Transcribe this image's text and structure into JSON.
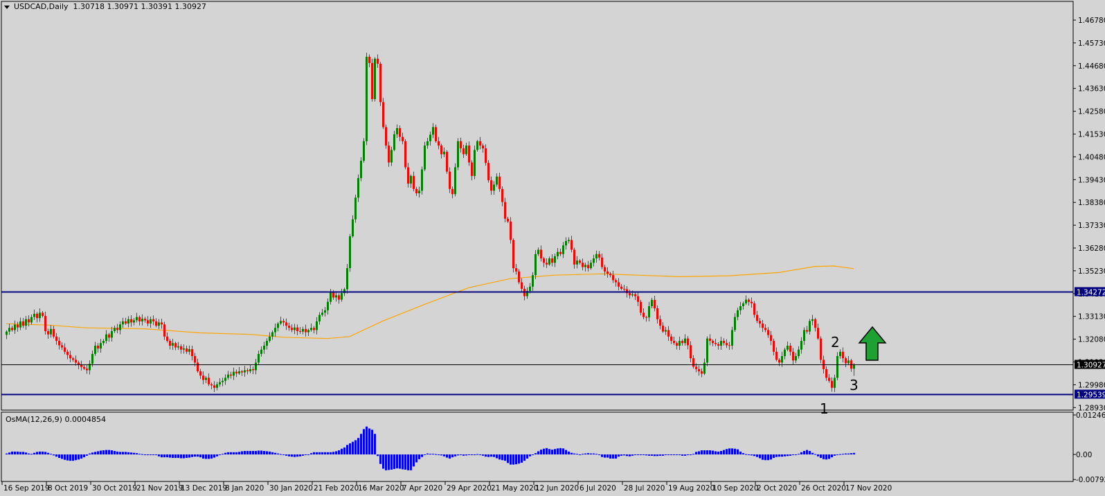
{
  "header": {
    "symbol": "USDCAD,Daily",
    "ohlc": "1.30718 1.30971 1.30391 1.30927"
  },
  "osma_label": {
    "name": "OsMA(12,26,9)",
    "value": "0.0004854"
  },
  "colors": {
    "background": "#d4d4d4",
    "bull": "#008000",
    "bear": "#ff0000",
    "ma": "#ffa500",
    "level": "#000080",
    "bid": "#000000",
    "osma": "#0000ff",
    "arrow": "#1ea133"
  },
  "annotations": {
    "wave1": "1",
    "wave2": "2",
    "wave3": "3",
    "arrow_icon": "up-arrow-icon"
  },
  "chart_data": [
    {
      "type": "candlestick",
      "title": "USDCAD,Daily",
      "last_bar": {
        "open": 1.30718,
        "high": 1.30971,
        "low": 1.30391,
        "close": 1.30927
      },
      "ylim": [
        1.2893,
        1.4678
      ],
      "yaxis_ticks": [
        "1.46780",
        "1.45730",
        "1.44680",
        "1.43630",
        "1.42580",
        "1.41530",
        "1.40480",
        "1.39430",
        "1.38380",
        "1.37330",
        "1.36280",
        "1.35230",
        "1.34180",
        "1.33130",
        "1.32080",
        "1.31030",
        "1.29980",
        "1.28930"
      ],
      "date_labels": [
        "16 Sep 2019",
        "8 Oct 2019",
        "30 Oct 2019",
        "21 Nov 2019",
        "13 Dec 2019",
        "8 Jan 2020",
        "30 Jan 2020",
        "21 Feb 2020",
        "16 Mar 2020",
        "7 Apr 2020",
        "29 Apr 2020",
        "21 May 2020",
        "12 Jun 2020",
        "6 Jul 2020",
        "28 Jul 2020",
        "19 Aug 2020",
        "10 Sep 2020",
        "2 Oct 2020",
        "26 Oct 2020",
        "17 Nov 2020"
      ],
      "horizontal_levels": [
        {
          "price": 1.34272,
          "label": "1.34272",
          "style": "level"
        },
        {
          "price": 1.30927,
          "label": "1.30927",
          "style": "bid"
        },
        {
          "price": 1.29539,
          "label": "1.29539",
          "style": "level"
        }
      ],
      "close": [
        1.3243,
        1.326,
        1.325,
        1.3275,
        1.3262,
        1.329,
        1.327,
        1.33,
        1.3285,
        1.331,
        1.3325,
        1.3305,
        1.333,
        1.3315,
        1.3245,
        1.323,
        1.3255,
        1.322,
        1.32,
        1.318,
        1.317,
        1.315,
        1.3135,
        1.312,
        1.3113,
        1.31,
        1.309,
        1.308,
        1.3072,
        1.3065,
        1.3095,
        1.314,
        1.3178,
        1.3165,
        1.319,
        1.32,
        1.323,
        1.3215,
        1.3245,
        1.326,
        1.325,
        1.3276,
        1.329,
        1.328,
        1.33,
        1.3285,
        1.3295,
        1.331,
        1.329,
        1.3302,
        1.3295,
        1.328,
        1.33,
        1.329,
        1.327,
        1.3285,
        1.3276,
        1.322,
        1.32,
        1.3178,
        1.319,
        1.317,
        1.3175,
        1.316,
        1.3165,
        1.315,
        1.3162,
        1.313,
        1.31,
        1.306,
        1.304,
        1.302,
        1.303,
        1.3,
        1.2995,
        1.2984,
        1.3,
        1.301,
        1.3016,
        1.303,
        1.3045,
        1.304,
        1.3058,
        1.305,
        1.306,
        1.3055,
        1.3065,
        1.306,
        1.307,
        1.3065,
        1.31,
        1.314,
        1.316,
        1.3178,
        1.32,
        1.322,
        1.324,
        1.326,
        1.328,
        1.3292,
        1.3285,
        1.327,
        1.326,
        1.325,
        1.3262,
        1.3245,
        1.3243,
        1.3255,
        1.324,
        1.325,
        1.326,
        1.325,
        1.329,
        1.332,
        1.333,
        1.3341,
        1.338,
        1.3422,
        1.34,
        1.341,
        1.339,
        1.342,
        1.3438,
        1.3535,
        1.3682,
        1.376,
        1.386,
        1.395,
        1.403,
        1.412,
        1.4509,
        1.448,
        1.4314,
        1.45,
        1.4477,
        1.43,
        1.4185,
        1.41,
        1.4022,
        1.408,
        1.4152,
        1.418,
        1.414,
        1.412,
        1.4,
        1.3925,
        1.396,
        1.39,
        1.388,
        1.3892,
        1.399,
        1.41,
        1.412,
        1.415,
        1.4185,
        1.412,
        1.41,
        1.406,
        1.4071,
        1.398,
        1.39,
        1.3876,
        1.4,
        1.412,
        1.4087,
        1.406,
        1.41,
        1.4022,
        1.396,
        1.408,
        1.412,
        1.41,
        1.4087,
        1.402,
        1.394,
        1.3892,
        1.392,
        1.3957,
        1.39,
        1.384,
        1.3763,
        1.375,
        1.3665,
        1.3535,
        1.352,
        1.347,
        1.344,
        1.3406,
        1.343,
        1.345,
        1.3503,
        1.36,
        1.362,
        1.358,
        1.356,
        1.3552,
        1.358,
        1.356,
        1.359,
        1.361,
        1.36,
        1.364,
        1.366,
        1.3665,
        1.362,
        1.3552,
        1.357,
        1.356,
        1.354,
        1.355,
        1.3535,
        1.356,
        1.358,
        1.36,
        1.3584,
        1.354,
        1.352,
        1.351,
        1.3503,
        1.348,
        1.347,
        1.345,
        1.344,
        1.3438,
        1.342,
        1.341,
        1.3415,
        1.3406,
        1.338,
        1.333,
        1.331,
        1.3308,
        1.336,
        1.3389,
        1.335,
        1.33,
        1.327,
        1.3243,
        1.325,
        1.322,
        1.32,
        1.319,
        1.3178,
        1.32,
        1.319,
        1.3211,
        1.318,
        1.312,
        1.3081,
        1.307,
        1.306,
        1.3049,
        1.31,
        1.3211,
        1.32,
        1.319,
        1.3185,
        1.3178,
        1.32,
        1.319,
        1.318,
        1.3178,
        1.325,
        1.331,
        1.3341,
        1.336,
        1.3373,
        1.339,
        1.338,
        1.3373,
        1.332,
        1.3292,
        1.328,
        1.326,
        1.325,
        1.3227,
        1.32,
        1.315,
        1.3113,
        1.31,
        1.313,
        1.316,
        1.3178,
        1.315,
        1.311,
        1.313,
        1.316,
        1.32,
        1.325,
        1.3243,
        1.3292,
        1.33,
        1.326,
        1.3211,
        1.3113,
        1.307,
        1.303,
        1.3016,
        1.2984,
        1.303,
        1.313,
        1.315,
        1.312,
        1.3097,
        1.311,
        1.3072,
        1.30927
      ],
      "moving_average": [
        [
          0,
          1.3279
        ],
        [
          15,
          1.3273
        ],
        [
          29,
          1.326
        ],
        [
          50,
          1.3256
        ],
        [
          70,
          1.3237
        ],
        [
          88,
          1.323
        ],
        [
          100,
          1.3217
        ],
        [
          116,
          1.3211
        ],
        [
          124,
          1.322
        ],
        [
          136,
          1.3292
        ],
        [
          152,
          1.3373
        ],
        [
          167,
          1.3445
        ],
        [
          182,
          1.3487
        ],
        [
          198,
          1.3503
        ],
        [
          215,
          1.3509
        ],
        [
          228,
          1.3503
        ],
        [
          243,
          1.3496
        ],
        [
          261,
          1.35
        ],
        [
          279,
          1.3515
        ],
        [
          292,
          1.3543
        ],
        [
          299,
          1.3545
        ],
        [
          306,
          1.3533
        ]
      ]
    },
    {
      "type": "bar",
      "title": "OsMA(12,26,9)",
      "ylim": [
        -0.007921,
        0.0124628
      ],
      "yaxis_ticks": [
        "0.0124628",
        "0.00",
        "-0.007921"
      ],
      "values": [
        0.0003,
        0.0006,
        0.0009,
        0.0009,
        0.0009,
        0.0008,
        0.0008,
        0.0006,
        0.0003,
        0.0002,
        0.0005,
        0.0008,
        0.0009,
        0.0009,
        0.0008,
        0.0005,
        0.0002,
        -0.0003,
        -0.0007,
        -0.0011,
        -0.0014,
        -0.0017,
        -0.0019,
        -0.002,
        -0.002,
        -0.0018,
        -0.0016,
        -0.0013,
        -0.0009,
        -0.0004,
        0.0003,
        0.0006,
        0.0008,
        0.001,
        0.0012,
        0.0013,
        0.0014,
        0.0014,
        0.0013,
        0.0011,
        0.0009,
        0.0008,
        0.0008,
        0.0008,
        0.0007,
        0.0006,
        0.0005,
        0.0004,
        0.0002,
        0.0001,
        0.0,
        -0.0001,
        -0.0002,
        -0.0001,
        0.0,
        -0.0006,
        -0.0009,
        -0.0009,
        -0.0009,
        -0.001,
        -0.0011,
        -0.0011,
        -0.0011,
        -0.0012,
        -0.0012,
        -0.0011,
        -0.001,
        -0.0008,
        -0.0007,
        -0.0007,
        -0.0009,
        -0.0013,
        -0.0014,
        -0.0014,
        -0.0013,
        -0.001,
        -0.0006,
        -0.0002,
        0.0002,
        0.0005,
        0.0007,
        0.0007,
        0.0007,
        0.0007,
        0.0008,
        0.001,
        0.0011,
        0.0011,
        0.0011,
        0.0011,
        0.0011,
        0.0012,
        0.0012,
        0.0011,
        0.001,
        0.0009,
        0.0007,
        0.0005,
        0.0003,
        0.0001,
        -0.0002,
        -0.0004,
        -0.0006,
        -0.0007,
        -0.0008,
        -0.0007,
        -0.0006,
        -0.0004,
        -0.0002,
        0.0,
        0.0004,
        0.0007,
        0.0007,
        0.0007,
        0.0007,
        0.0007,
        0.0007,
        0.0007,
        0.0008,
        0.001,
        0.0013,
        0.0018,
        0.0022,
        0.003,
        0.0035,
        0.004,
        0.0045,
        0.0052,
        0.0065,
        0.008,
        0.0088,
        0.0082,
        0.0078,
        0.0065,
        -0.0005,
        -0.003,
        -0.0045,
        -0.005,
        -0.0049,
        -0.0048,
        -0.0046,
        -0.0044,
        -0.0045,
        -0.0047,
        -0.0048,
        -0.005,
        -0.005,
        -0.0038,
        -0.0025,
        -0.0015,
        -0.0008,
        -0.0002,
        0.0003,
        0.0002,
        0.0002,
        0.0001,
        0.0,
        -0.0003,
        -0.0006,
        -0.001,
        -0.0013,
        -0.0009,
        -0.0006,
        -0.0003,
        -0.0002,
        -0.0004,
        -0.0003,
        -0.0002,
        -0.0001,
        0.0,
        0.0001,
        -0.0002,
        -0.0004,
        -0.0007,
        -0.0008,
        -0.0007,
        -0.0008,
        -0.0012,
        -0.0016,
        -0.0018,
        -0.002,
        -0.0027,
        -0.0032,
        -0.0032,
        -0.0031,
        -0.0029,
        -0.0026,
        -0.002,
        -0.0013,
        -0.0006,
        0.0,
        0.0004,
        0.001,
        0.0015,
        0.0018,
        0.002,
        0.0017,
        0.0015,
        0.0017,
        0.0019,
        0.002,
        0.0019,
        0.0014,
        0.0009,
        0.0005,
        0.0003,
        0.0002,
        -0.0001,
        0.0002,
        0.0003,
        0.0004,
        0.0003,
        0.0003,
        0.0002,
        -0.0002,
        -0.0008,
        -0.001,
        -0.001,
        -0.0013,
        -0.0013,
        -0.0013,
        -0.0007,
        -0.0004,
        -0.0003,
        -0.0005,
        -0.0006,
        -0.0004,
        -0.0002,
        0.0,
        -0.0001,
        -0.0002,
        -0.0003,
        -0.0004,
        -0.0004,
        -0.0005,
        -0.0005,
        -0.0004,
        -0.0004,
        -0.0002,
        -0.0001,
        -0.0001,
        -0.0001,
        -0.0001,
        -0.0002,
        -0.0004,
        -0.0004,
        -0.0002,
        -0.0001,
        0.0002,
        0.0008,
        0.001,
        0.0013,
        0.0013,
        0.0013,
        0.0013,
        0.0012,
        0.001,
        0.0009,
        0.0011,
        0.0014,
        0.0017,
        0.0019,
        0.0019,
        0.0018,
        0.0016,
        0.0009,
        0.0004,
        0.0001,
        -0.0002,
        -0.0003,
        -0.0005,
        -0.0008,
        -0.0012,
        -0.0017,
        -0.0018,
        -0.0018,
        -0.0016,
        -0.0011,
        -0.0008,
        -0.0007,
        -0.0007,
        -0.0006,
        -0.0005,
        -0.0004,
        -0.0002,
        0.0,
        0.0002,
        0.0007,
        0.0011,
        0.0014,
        0.0011,
        0.0005,
        0.0001,
        -0.0006,
        -0.0011,
        -0.0015,
        -0.0016,
        -0.0014,
        -0.0009,
        -0.0004,
        -0.0002,
        0.0001,
        0.0002,
        0.0003,
        0.0003,
        0.0004,
        0.0004854
      ]
    }
  ]
}
